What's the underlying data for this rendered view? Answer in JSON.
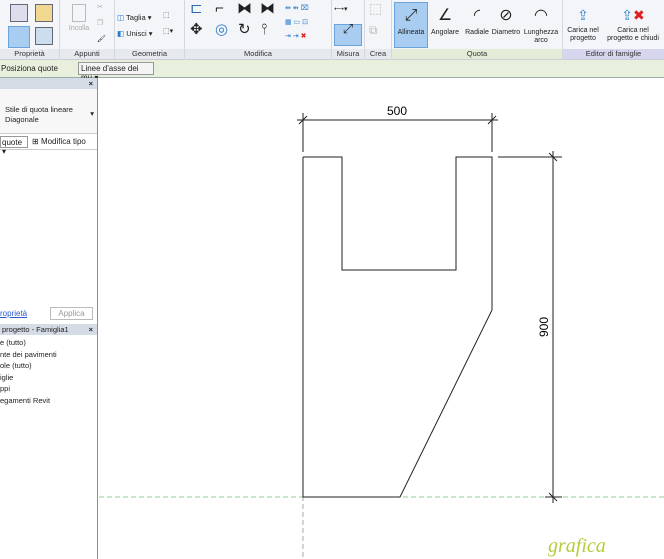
{
  "ribbon": {
    "groups": {
      "proprieta": "Proprietà",
      "appunti": "Appunti",
      "geometria": "Geometria",
      "modifica": "Modifica",
      "misura": "Misura",
      "crea": "Crea",
      "quota": "Quota",
      "editor": "Editor di famiglie"
    },
    "incolla": "Incolla",
    "taglia": "Taglia",
    "unisci": "Unisci",
    "quota_tools": [
      "Allineata",
      "Angolare",
      "Radiale",
      "Diametro",
      "Lunghezza",
      "arco"
    ],
    "carica": [
      "Carica nel",
      "progetto"
    ],
    "carica_chiudi": [
      "Carica nel",
      "progetto e chiudi"
    ]
  },
  "options": {
    "label": "Posiziona quote",
    "select": "Linee d'asse dei mu"
  },
  "properties": {
    "type_line1": "Stile di quota lineare",
    "type_line2": "Diagonale",
    "filter": "quote",
    "edit_type": "Modifica tipo",
    "help_link": "roprietà",
    "apply": "Applica"
  },
  "browser": {
    "title": "progetto - Famiglia1",
    "items": [
      "e (tutto)",
      "nte dei pavimenti",
      "ole (tutto)",
      "iglie",
      "ppi",
      "egamenti Revit"
    ]
  },
  "drawing": {
    "dim_horizontal": "500",
    "dim_vertical": "900",
    "watermark": "grafica"
  },
  "colors": {
    "accent": "#a9cdf1",
    "options_bar": "#e8f0dd",
    "reference_line": "#8fd08f"
  }
}
